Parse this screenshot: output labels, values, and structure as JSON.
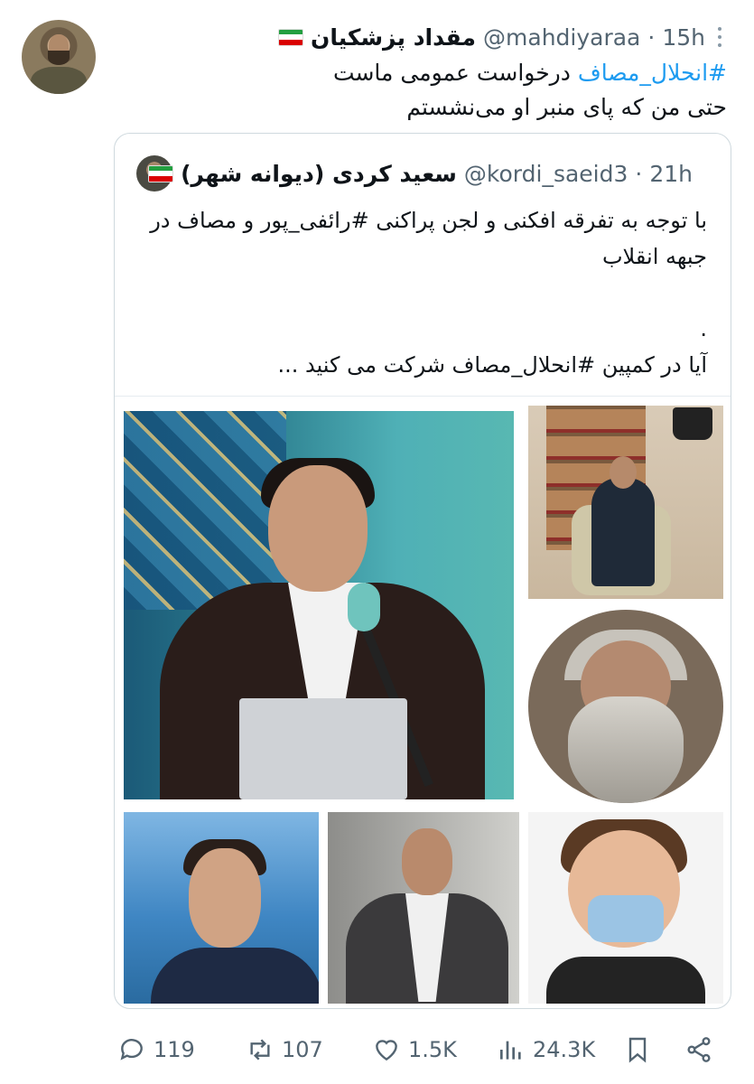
{
  "tweet": {
    "author_name": "مقداد پزشکیان",
    "handle": "@mahdiyaraa",
    "separator": "·",
    "time": "15h",
    "text_hashtag": "#انحلال_مصاف",
    "text_line1_rest": " درخواست عمومی ماست",
    "text_line2": "حتی من که پای منبر او می‌نشستم"
  },
  "quote": {
    "author_name": "سعید کردی (دیوانه شهر)",
    "handle": "@kordi_saeid3",
    "separator": "·",
    "time": "21h",
    "text": "با توجه به تفرقه افکنی و لجن پراکنی #رائفی_پور و مصاف در جبهه انقلاب\n\n.\nآیا در کمپین #انحلال_مصاف شرکت می کنید ...\n\n...."
  },
  "actions": {
    "replies": "119",
    "retweets": "107",
    "likes": "1.5K",
    "views": "24.3K"
  },
  "colors": {
    "accent": "#1d9bf0",
    "muted": "#536471",
    "border": "#cfd9de"
  }
}
